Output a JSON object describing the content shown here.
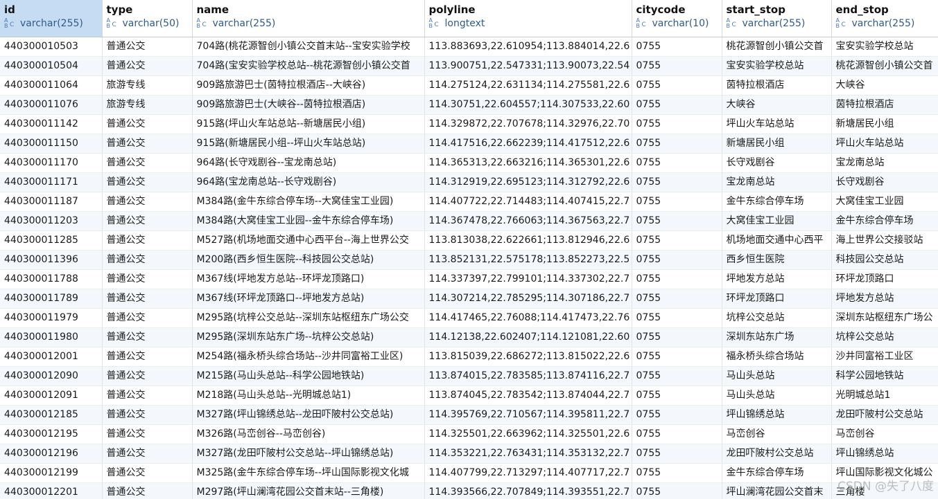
{
  "columns": [
    {
      "name": "id",
      "type": "varchar(255)"
    },
    {
      "name": "type",
      "type": "varchar(50)"
    },
    {
      "name": "name",
      "type": "varchar(255)"
    },
    {
      "name": "polyline",
      "type": "longtext"
    },
    {
      "name": "citycode",
      "type": "varchar(10)"
    },
    {
      "name": "start_stop",
      "type": "varchar(255)"
    },
    {
      "name": "end_stop",
      "type": "varchar(255)"
    }
  ],
  "rows": [
    [
      "440300010503",
      "普通公交",
      "704路(桃花源智创小镇公交首末站--宝安实验学校",
      "113.883693,22.610954;113.884014,22.6",
      "0755",
      "桃花源智创小镇公交首",
      "宝安实验学校总站"
    ],
    [
      "440300010504",
      "普通公交",
      "704路(宝安实验学校总站--桃花源智创小镇公交首",
      "113.900751,22.547331;113.90073,22.54",
      "0755",
      "宝安实验学校总站",
      "桃花源智创小镇公交首"
    ],
    [
      "440300011064",
      "旅游专线",
      "909路旅游巴士(茵特拉根酒店--大峡谷)",
      "114.275124,22.631134;114.275581,22.6",
      "0755",
      "茵特拉根酒店",
      "大峡谷"
    ],
    [
      "440300011076",
      "旅游专线",
      "909路旅游巴士(大峡谷--茵特拉根酒店)",
      "114.30751,22.604557;114.307533,22.60",
      "0755",
      "大峡谷",
      "茵特拉根酒店"
    ],
    [
      "440300011142",
      "普通公交",
      "915路(坪山火车站总站--新塘居民小组)",
      "114.329872,22.707678;114.32976,22.70",
      "0755",
      "坪山火车站总站",
      "新塘居民小组"
    ],
    [
      "440300011150",
      "普通公交",
      "915路(新塘居民小组--坪山火车站总站)",
      "114.417516,22.662239;114.417512,22.6",
      "0755",
      "新塘居民小组",
      "坪山火车站总站"
    ],
    [
      "440300011170",
      "普通公交",
      "964路(长守戏剧谷--宝龙南总站)",
      "114.365313,22.663216;114.365301,22.6",
      "0755",
      "长守戏剧谷",
      "宝龙南总站"
    ],
    [
      "440300011171",
      "普通公交",
      "964路(宝龙南总站--长守戏剧谷)",
      "114.312919,22.695123;114.312792,22.6",
      "0755",
      "宝龙南总站",
      "长守戏剧谷"
    ],
    [
      "440300011187",
      "普通公交",
      "M384路(金牛东综合停车场--大窝佳宝工业园)",
      "114.407722,22.714483;114.407415,22.7",
      "0755",
      "金牛东综合停车场",
      "大窝佳宝工业园"
    ],
    [
      "440300011203",
      "普通公交",
      "M384路(大窝佳宝工业园--金牛东综合停车场)",
      "114.367478,22.766063;114.367563,22.7",
      "0755",
      "大窝佳宝工业园",
      "金牛东综合停车场"
    ],
    [
      "440300011285",
      "普通公交",
      "M527路(机场地面交通中心西平台--海上世界公交",
      "113.813038,22.622661;113.812946,22.6",
      "0755",
      "机场地面交通中心西平",
      "海上世界公交接驳站"
    ],
    [
      "440300011396",
      "普通公交",
      "M200路(西乡恒生医院--科技园公交总站)",
      "113.852131,22.575178;113.852273,22.5",
      "0755",
      "西乡恒生医院",
      "科技园公交总站"
    ],
    [
      "440300011788",
      "普通公交",
      "M367线(坪地发方总站--环坪龙顶路口)",
      "114.337397,22.799101;114.337302,22.7",
      "0755",
      "坪地发方总站",
      "环坪龙顶路口"
    ],
    [
      "440300011789",
      "普通公交",
      "M367线(环坪龙顶路口--坪地发方总站)",
      "114.307214,22.785295;114.307186,22.7",
      "0755",
      "环坪龙顶路口",
      "坪地发方总站"
    ],
    [
      "440300011979",
      "普通公交",
      "M295路(坑梓公交总站--深圳东站枢纽东广场公交",
      "114.417465,22.76088;114.417473,22.76",
      "0755",
      "坑梓公交总站",
      "深圳东站枢纽东广场公"
    ],
    [
      "440300011980",
      "普通公交",
      "M295路(深圳东站东广场--坑梓公交总站)",
      "114.12138,22.602407;114.121081,22.60",
      "0755",
      "深圳东站东广场",
      "坑梓公交总站"
    ],
    [
      "440300012001",
      "普通公交",
      "M254路(福永桥头综合场站--沙井同富裕工业区)",
      "113.815039,22.686272;113.815022,22.6",
      "0755",
      "福永桥头综合场站",
      "沙井同富裕工业区"
    ],
    [
      "440300012090",
      "普通公交",
      "M215路(马山头总站--科学公园地铁站)",
      "113.874015,22.783585;113.874116,22.7",
      "0755",
      "马山头总站",
      "科学公园地铁站"
    ],
    [
      "440300012091",
      "普通公交",
      "M218路(马山头总站--光明城总站1)",
      "113.874045,22.783542;113.874044,22.7",
      "0755",
      "马山头总站",
      "光明城总站1"
    ],
    [
      "440300012185",
      "普通公交",
      "M327路(坪山锦绣总站--龙田吓陂村公交总站)",
      "114.395769,22.710567;114.395811,22.7",
      "0755",
      "坪山锦绣总站",
      "龙田吓陂村公交总站"
    ],
    [
      "440300012195",
      "普通公交",
      "M326路(马峦创谷--马峦创谷)",
      "114.325501,22.663962;114.325501,22.6",
      "0755",
      "马峦创谷",
      "马峦创谷"
    ],
    [
      "440300012196",
      "普通公交",
      "M327路(龙田吓陂村公交总站--坪山锦绣总站)",
      "114.353221,22.763431;114.353132,22.7",
      "0755",
      "龙田吓陂村公交总站",
      "坪山锦绣总站"
    ],
    [
      "440300012199",
      "普通公交",
      "M325路(金牛东综合停车场--坪山国际影视文化城",
      "114.407799,22.713297;114.407717,22.7",
      "0755",
      "金牛东综合停车场",
      "坪山国际影视文化城公"
    ],
    [
      "440300012201",
      "普通公交",
      "M297路(坪山澜湾花园公交首末站--三角楼)",
      "114.393566,22.707849;114.393551,22.7",
      "0755",
      "坪山澜湾花园公交首末",
      "三角楼"
    ]
  ],
  "watermark": "CSDN @失了八度"
}
